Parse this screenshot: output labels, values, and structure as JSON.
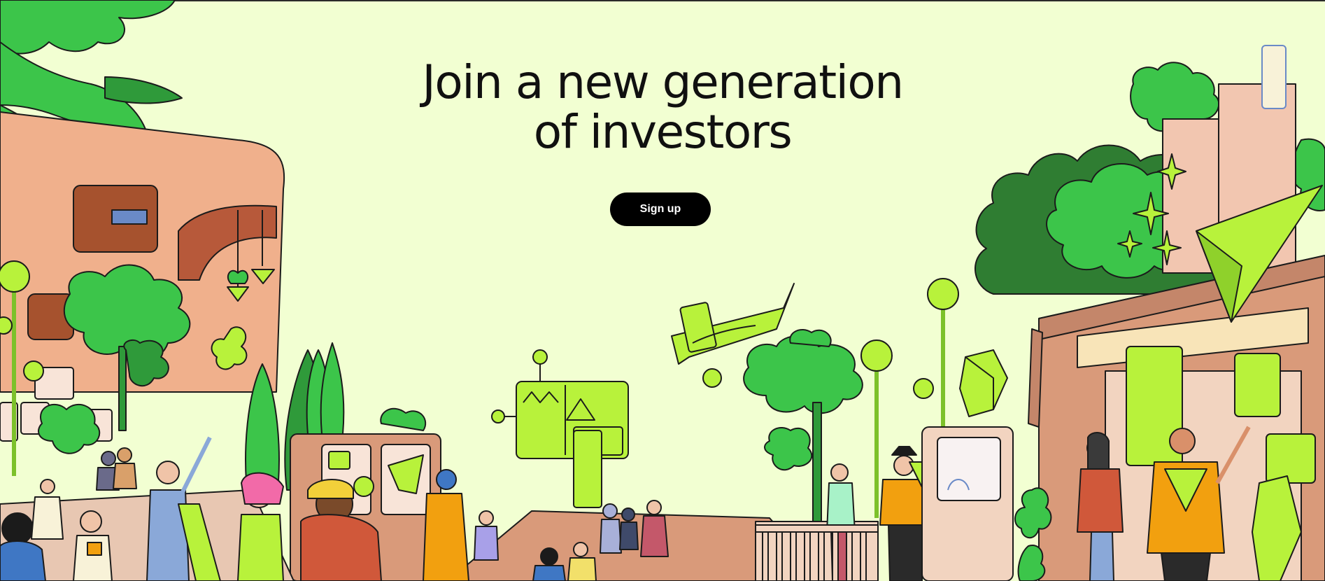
{
  "hero": {
    "headline_line1": "Join a new generation",
    "headline_line2": "of investors",
    "signup_label": "Sign up"
  },
  "colors": {
    "background": "#f2ffd2",
    "button": "#000000",
    "button_text": "#ffffff",
    "leaf_dark": "#2f7d32",
    "leaf_mid": "#3cc54a",
    "leaf_light": "#b8f23b",
    "building": "#f0b08c",
    "building_dark": "#d99a7a",
    "accent_orange": "#f2a00f",
    "accent_blue": "#3f77c4"
  }
}
